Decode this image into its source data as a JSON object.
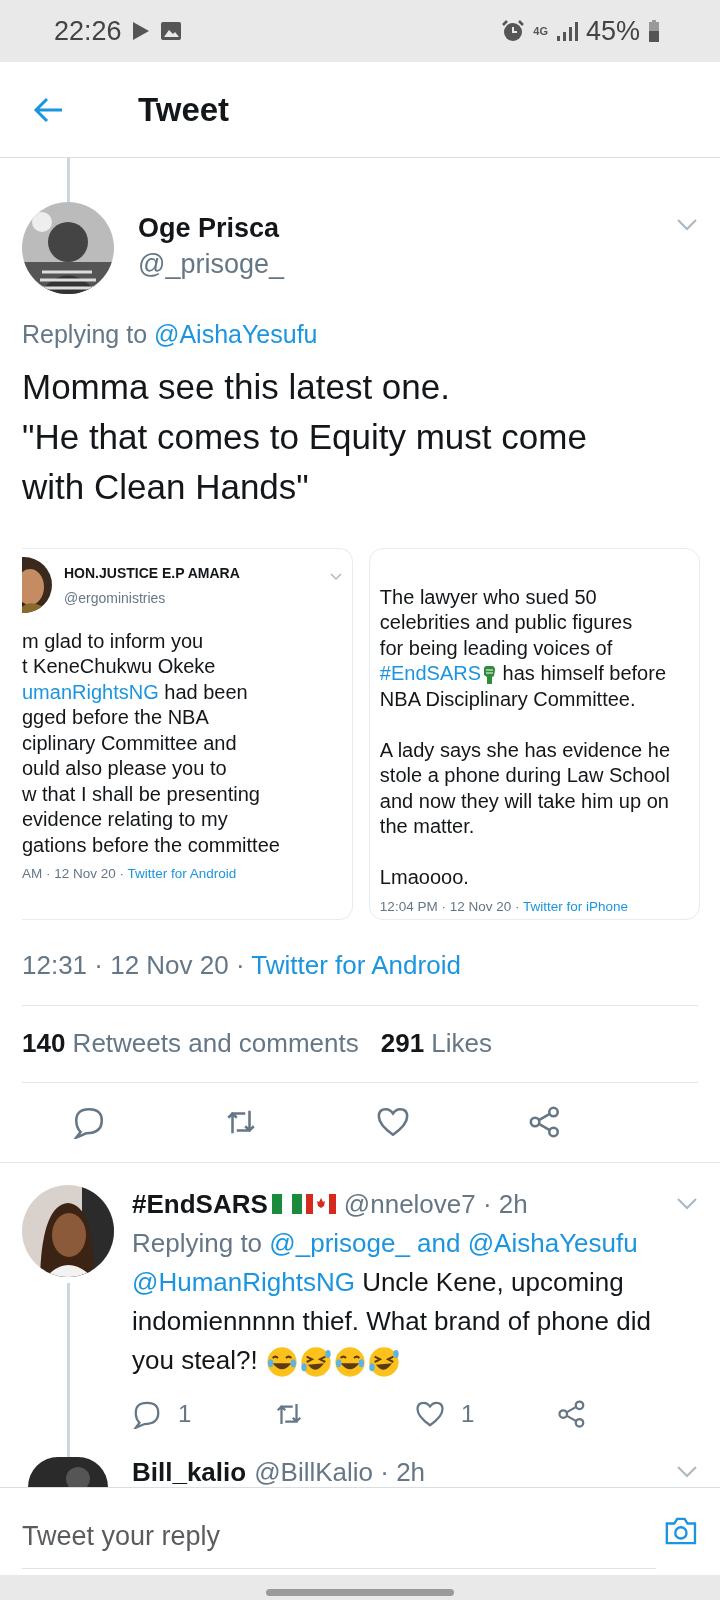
{
  "status_bar": {
    "time": "22:26",
    "network": "4G",
    "battery": "45%"
  },
  "header": {
    "title": "Tweet"
  },
  "tweet": {
    "name": "Oge Prisca",
    "handle": "@_prisoge_",
    "replying": [
      {
        "text": "Replying to ",
        "kind": "text"
      },
      {
        "text": "@AishaYesufu",
        "kind": "link"
      }
    ],
    "text": "Momma see this latest one.\n\"He that comes to Equity must come with Clean Hands\"",
    "embeds": [
      {
        "name": "HON.JUSTICE E.P AMARA",
        "handle": "@ergoministries",
        "lines": [
          [
            {
              "text": "m glad to inform you",
              "kind": "text"
            }
          ],
          [
            {
              "text": "t KeneChukwu Okeke",
              "kind": "text"
            }
          ],
          [
            {
              "text": "umanRightsNG",
              "kind": "link"
            },
            {
              "text": " had been",
              "kind": "text"
            }
          ],
          [
            {
              "text": "gged before the NBA",
              "kind": "text"
            }
          ],
          [
            {
              "text": "ciplinary Committee and",
              "kind": "text"
            }
          ],
          [
            {
              "text": "ould also please you to",
              "kind": "text"
            }
          ],
          [
            {
              "text": "w that I shall be presenting",
              "kind": "text"
            }
          ],
          [
            {
              "text": "evidence relating to my",
              "kind": "text"
            }
          ],
          [
            {
              "text": "gations before the committee",
              "kind": "text"
            }
          ]
        ],
        "meta": "AM · 12 Nov 20 · ",
        "source": "Twitter for Android"
      },
      {
        "lines": [
          [
            {
              "text": "The lawyer who sued 50",
              "kind": "text"
            }
          ],
          [
            {
              "text": "celebrities and public figures",
              "kind": "text"
            }
          ],
          [
            {
              "text": "for being leading voices of",
              "kind": "text"
            }
          ],
          [
            {
              "text": "#EndSARS",
              "kind": "link"
            },
            {
              "kind": "fist"
            },
            {
              "text": " has himself before",
              "kind": "text"
            }
          ],
          [
            {
              "text": "NBA Disciplinary Committee.",
              "kind": "text"
            }
          ],
          [
            {
              "kind": "gap"
            }
          ],
          [
            {
              "text": "A lady says she has evidence he",
              "kind": "text"
            }
          ],
          [
            {
              "text": "stole a phone during Law School",
              "kind": "text"
            }
          ],
          [
            {
              "text": "and now they will take him up on",
              "kind": "text"
            }
          ],
          [
            {
              "text": "the matter.",
              "kind": "text"
            }
          ],
          [
            {
              "kind": "gap"
            }
          ],
          [
            {
              "text": "Lmaoooo.",
              "kind": "text"
            }
          ]
        ],
        "meta": "12:04 PM · 12 Nov 20 · ",
        "source": "Twitter for iPhone"
      }
    ],
    "time": "12:31 · 12 Nov 20 · ",
    "source": "Twitter for Android",
    "stats": [
      {
        "count": "140",
        "label": "Retweets and comments"
      },
      {
        "count": "291",
        "label": "Likes"
      }
    ]
  },
  "replies": [
    {
      "name": "#EndSARS",
      "flags": [
        {
          "kind": "nigeria"
        },
        {
          "kind": "canada"
        }
      ],
      "handle": "@nnelove7 · 2h",
      "replying": [
        {
          "text": "Replying to ",
          "kind": "text"
        },
        {
          "text": "@_prisoge_ and @AishaYesufu",
          "kind": "link"
        }
      ],
      "body": [
        {
          "text": "@HumanRightsNG",
          "kind": "link"
        },
        {
          "text": " Uncle Kene, upcoming indomiennnnn thief. What brand of phone did you steal?! ",
          "kind": "text"
        },
        {
          "kind": "joy"
        },
        {
          "kind": "rofl"
        },
        {
          "kind": "joy"
        },
        {
          "kind": "rofl"
        }
      ],
      "replies": "1",
      "likes": "1"
    },
    {
      "name": "Bill_kalio",
      "handle": "@BillKalio · 2h"
    }
  ],
  "reply_box": {
    "placeholder": "Tweet your reply"
  }
}
